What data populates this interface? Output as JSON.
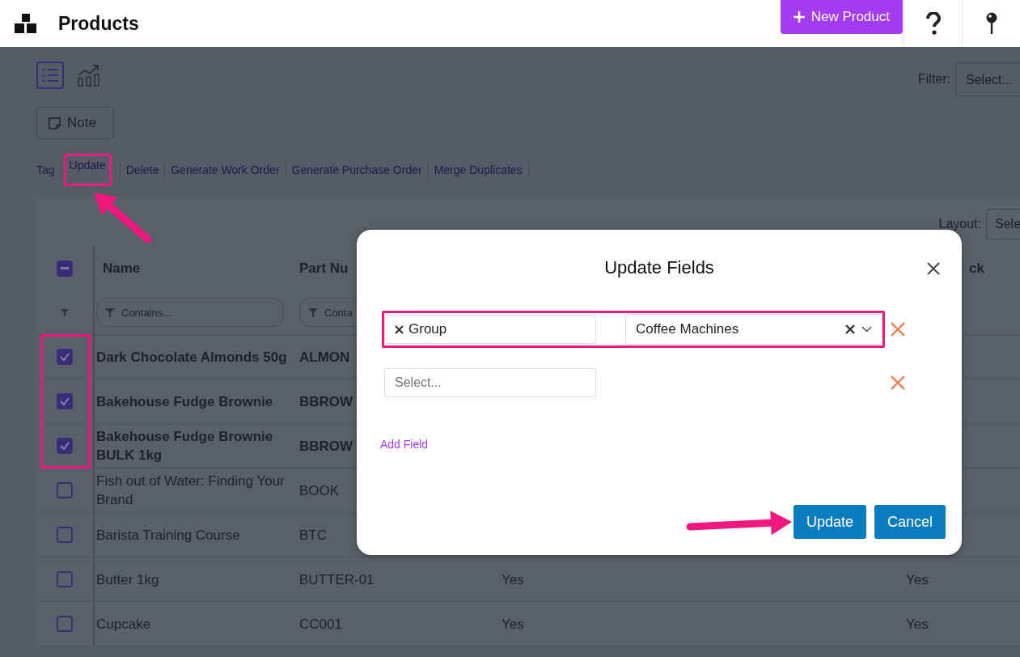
{
  "header": {
    "title": "Products",
    "new_button": "New Product"
  },
  "view_tabs": [
    {
      "kind": "list",
      "selected": true
    },
    {
      "kind": "chart",
      "selected": false
    }
  ],
  "filter": {
    "label": "Filter:",
    "placeholder": "Select..."
  },
  "note_button": "Note",
  "actions": [
    {
      "label": "Tag",
      "highlighted": false
    },
    {
      "label": "Update",
      "highlighted": true
    },
    {
      "label": "Delete",
      "highlighted": false
    },
    {
      "label": "Generate Work Order",
      "highlighted": false
    },
    {
      "label": "Generate Purchase Order",
      "highlighted": false
    },
    {
      "label": "Merge Duplicates",
      "highlighted": false
    }
  ],
  "layout": {
    "label": "Layout:",
    "placeholder": "Sele"
  },
  "table": {
    "select_all_indeterminate": true,
    "header": {
      "name": "Name",
      "part_number": "Part Nu",
      "column_4": "ck"
    },
    "filter_placeholders": [
      "Contains...",
      "Conta"
    ],
    "rows": [
      {
        "name": "Dark Chocolate Almonds 50g",
        "part_number": "ALMON",
        "checked": true,
        "highlighted": true
      },
      {
        "name": "Bakehouse Fudge Brownie",
        "part_number": "BBROW",
        "checked": true,
        "highlighted": true
      },
      {
        "name": "Bakehouse Fudge Brownie BULK 1kg",
        "part_number": "BBROW",
        "checked": true,
        "highlighted": true
      },
      {
        "name": "Fish out of Water: Finding Your Brand",
        "part_number": "BOOK",
        "checked": false,
        "highlighted": false
      },
      {
        "name": "Barista Training Course",
        "part_number": "BTC",
        "checked": false,
        "highlighted": false
      },
      {
        "name": "Butter 1kg",
        "part_number": "BUTTER-01",
        "column_3": "Yes",
        "column_4": "Yes",
        "checked": false,
        "highlighted": false
      },
      {
        "name": "Cupcake",
        "part_number": "CC001",
        "column_3": "Yes",
        "column_4": "Yes",
        "checked": false,
        "highlighted": false
      }
    ]
  },
  "modal": {
    "title": "Update Fields",
    "rows": [
      {
        "field": "Group",
        "value": "Coffee Machines",
        "highlighted": true
      },
      {
        "placeholder": "Select...",
        "highlighted": false
      }
    ],
    "add_link": "Add Field",
    "buttons": [
      {
        "label": "Update",
        "pointed": true
      },
      {
        "label": "Cancel",
        "pointed": false
      }
    ]
  }
}
